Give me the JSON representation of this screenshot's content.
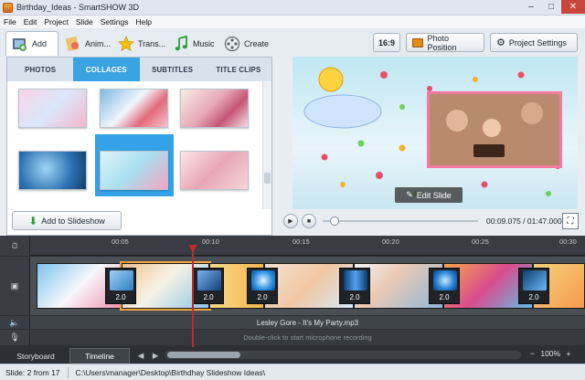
{
  "window": {
    "title": "Birthday_Ideas - SmartSHOW 3D",
    "minimize": "–",
    "maximize": "□",
    "close": "✕"
  },
  "menu": [
    "File",
    "Edit",
    "Project",
    "Slide",
    "Settings",
    "Help"
  ],
  "toolbar": {
    "tabs": [
      {
        "label": "Add",
        "icon": "add-icon"
      },
      {
        "label": "Anim...",
        "icon": "animation-icon"
      },
      {
        "label": "Trans...",
        "icon": "star-icon"
      },
      {
        "label": "Music",
        "icon": "music-icon"
      },
      {
        "label": "Create",
        "icon": "film-icon"
      }
    ],
    "aspect": "16:9",
    "photo_position": "Photo Position",
    "project_settings": "Project Settings"
  },
  "categories": [
    "PHOTOS",
    "COLLAGES",
    "SUBTITLES",
    "TITLE CLIPS"
  ],
  "add_to_slideshow": "Add to Slideshow",
  "preview": {
    "edit_slide": "Edit Slide"
  },
  "player": {
    "time": "00:09.075 / 01:47.000"
  },
  "ruler": [
    "00:05",
    "00:10",
    "00:15",
    "00:20",
    "00:25",
    "00:30"
  ],
  "transitions": [
    "2.0",
    "2.0",
    "2.0",
    "2.0",
    "2.0",
    "2.0"
  ],
  "music_track": "Lesley Gore - It's My Party.mp3",
  "voice_hint": "Double-click to start microphone recording",
  "bottom": {
    "storyboard": "Storyboard",
    "timeline": "Timeline",
    "zoom": "100%"
  },
  "status": {
    "slide": "Slide: 2 from 17",
    "path": "C:\\Users\\manager\\Desktop\\Birthdhay Slideshow Ideas\\"
  }
}
